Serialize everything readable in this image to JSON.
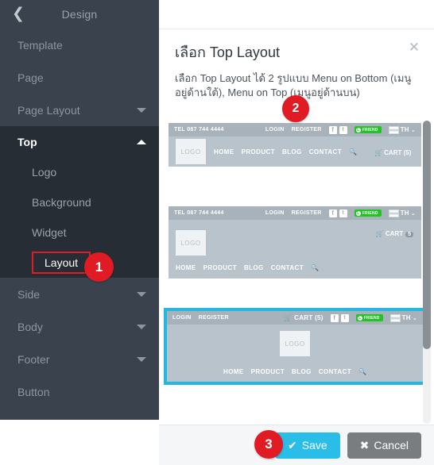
{
  "sidebar": {
    "header": {
      "title": "Design",
      "back_icon": "chevron-left-icon"
    },
    "items": [
      {
        "label": "Template",
        "caret": false
      },
      {
        "label": "Page",
        "caret": false
      },
      {
        "label": "Page Layout",
        "caret": true
      }
    ],
    "top_group": {
      "label": "Top",
      "caret": "up",
      "sub_items": [
        {
          "label": "Logo"
        },
        {
          "label": "Background"
        },
        {
          "label": "Widget"
        },
        {
          "label": "Layout",
          "highlighted": true
        }
      ]
    },
    "items_after": [
      {
        "label": "Side",
        "caret": true
      },
      {
        "label": "Body",
        "caret": true
      },
      {
        "label": "Footer",
        "caret": true
      },
      {
        "label": "Button",
        "caret": false
      }
    ]
  },
  "badges": {
    "one": "1",
    "two": "2",
    "three": "3"
  },
  "modal": {
    "title": "เลือก Top Layout",
    "close_icon": "close-icon",
    "description": "เลือก Top Layout ได้ 2 รูปแบบ Menu on Bottom (เมนูอยู่ด้านใต้), Menu on Top (เมนูอยู่ด้านบน)",
    "cards": [
      {
        "name": "menu-on-bottom-inline",
        "selected": false,
        "tel": "TEL 087 744 4444",
        "login": "LOGIN",
        "register": "REGISTER",
        "facebook": "f",
        "twitter": "t",
        "friend": "FRIEND",
        "lang": "TH",
        "lang_chevron": "⌄",
        "logo": "LOGO",
        "nav": [
          "HOME",
          "PRODUCT",
          "BLOG",
          "CONTACT"
        ],
        "search_icon": "search-icon",
        "cart": "CART (5)"
      },
      {
        "name": "menu-on-bottom-stacked",
        "selected": false,
        "tel": "TEL 087 744 4444",
        "login": "LOGIN",
        "register": "REGISTER",
        "facebook": "f",
        "twitter": "t",
        "friend": "FRIEND",
        "lang": "TH",
        "lang_chevron": "⌄",
        "logo": "LOGO",
        "nav": [
          "HOME",
          "PRODUCT",
          "BLOG",
          "CONTACT"
        ],
        "search_icon": "search-icon",
        "cart": "CART",
        "cart_count": "5"
      },
      {
        "name": "menu-on-top-centered",
        "selected": true,
        "login": "LOGIN",
        "register": "REGISTER",
        "cart": "CART (5)",
        "facebook": "f",
        "twitter": "t",
        "friend": "FRIEND",
        "lang": "TH",
        "lang_chevron": "⌄",
        "logo": "LOGO",
        "nav": [
          "HOME",
          "PRODUCT",
          "BLOG",
          "CONTACT"
        ],
        "search_icon": "search-icon"
      }
    ]
  },
  "footer": {
    "save_label": "Save",
    "save_icon": "check-icon",
    "cancel_label": "Cancel",
    "cancel_icon": "x-icon"
  },
  "colors": {
    "sidebar_bg": "#3a434d",
    "sidebar_active_bg": "#262d35",
    "badge_red": "#e01b24",
    "accent_cyan": "#29bde8",
    "cancel_gray": "#797d7f",
    "card_body": "#b9c3cc",
    "card_bar": "#a8b2bb",
    "line_green": "#22c322"
  }
}
